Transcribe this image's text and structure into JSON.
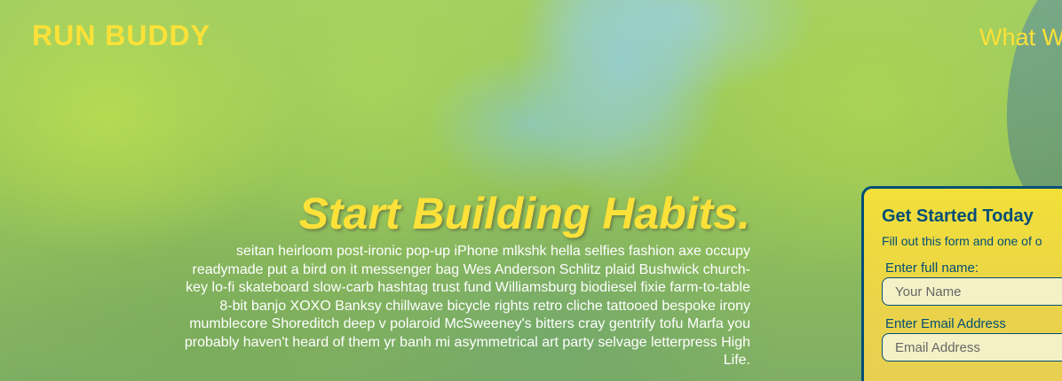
{
  "header": {
    "logo": "RUN BUDDY",
    "nav_partial": "What W"
  },
  "hero": {
    "title": "Start Building Habits.",
    "body": "seitan heirloom post-ironic pop-up iPhone mlkshk hella selfies fashion axe occupy readymade put a bird on it messenger bag Wes Anderson Schlitz plaid Bushwick church-key lo-fi skateboard slow-carb hashtag trust fund Williamsburg biodiesel fixie farm-to-table 8-bit banjo XOXO Banksy chillwave bicycle rights retro cliche tattooed bespoke irony mumblecore Shoreditch deep v polaroid McSweeney's bitters cray gentrify tofu Marfa you probably haven't heard of them yr banh mi asymmetrical art party selvage letterpress High Life."
  },
  "signup": {
    "title": "Get Started Today",
    "subtitle": "Fill out this form and one of o",
    "name_label": "Enter full name:",
    "name_placeholder": "Your Name",
    "email_label": "Enter Email Address",
    "email_placeholder": "Email Address"
  },
  "colors": {
    "accent_yellow": "#fce138",
    "brand_blue": "#024e76",
    "body_text": "#ffffff"
  }
}
